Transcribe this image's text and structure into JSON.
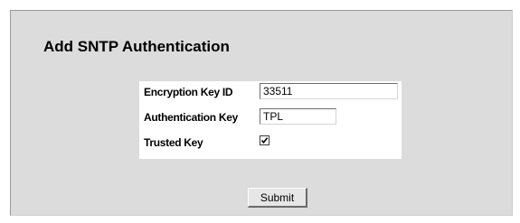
{
  "page": {
    "title": "Add SNTP Authentication"
  },
  "form": {
    "fields": [
      {
        "label": "Encryption Key ID",
        "value": "33511"
      },
      {
        "label": "Authentication Key",
        "value": "TPL"
      },
      {
        "label": "Trusted Key",
        "checked": true
      }
    ],
    "submit_label": "Submit"
  },
  "colors": {
    "panel_background": "#dcdcdc",
    "form_background": "#ffffff"
  }
}
